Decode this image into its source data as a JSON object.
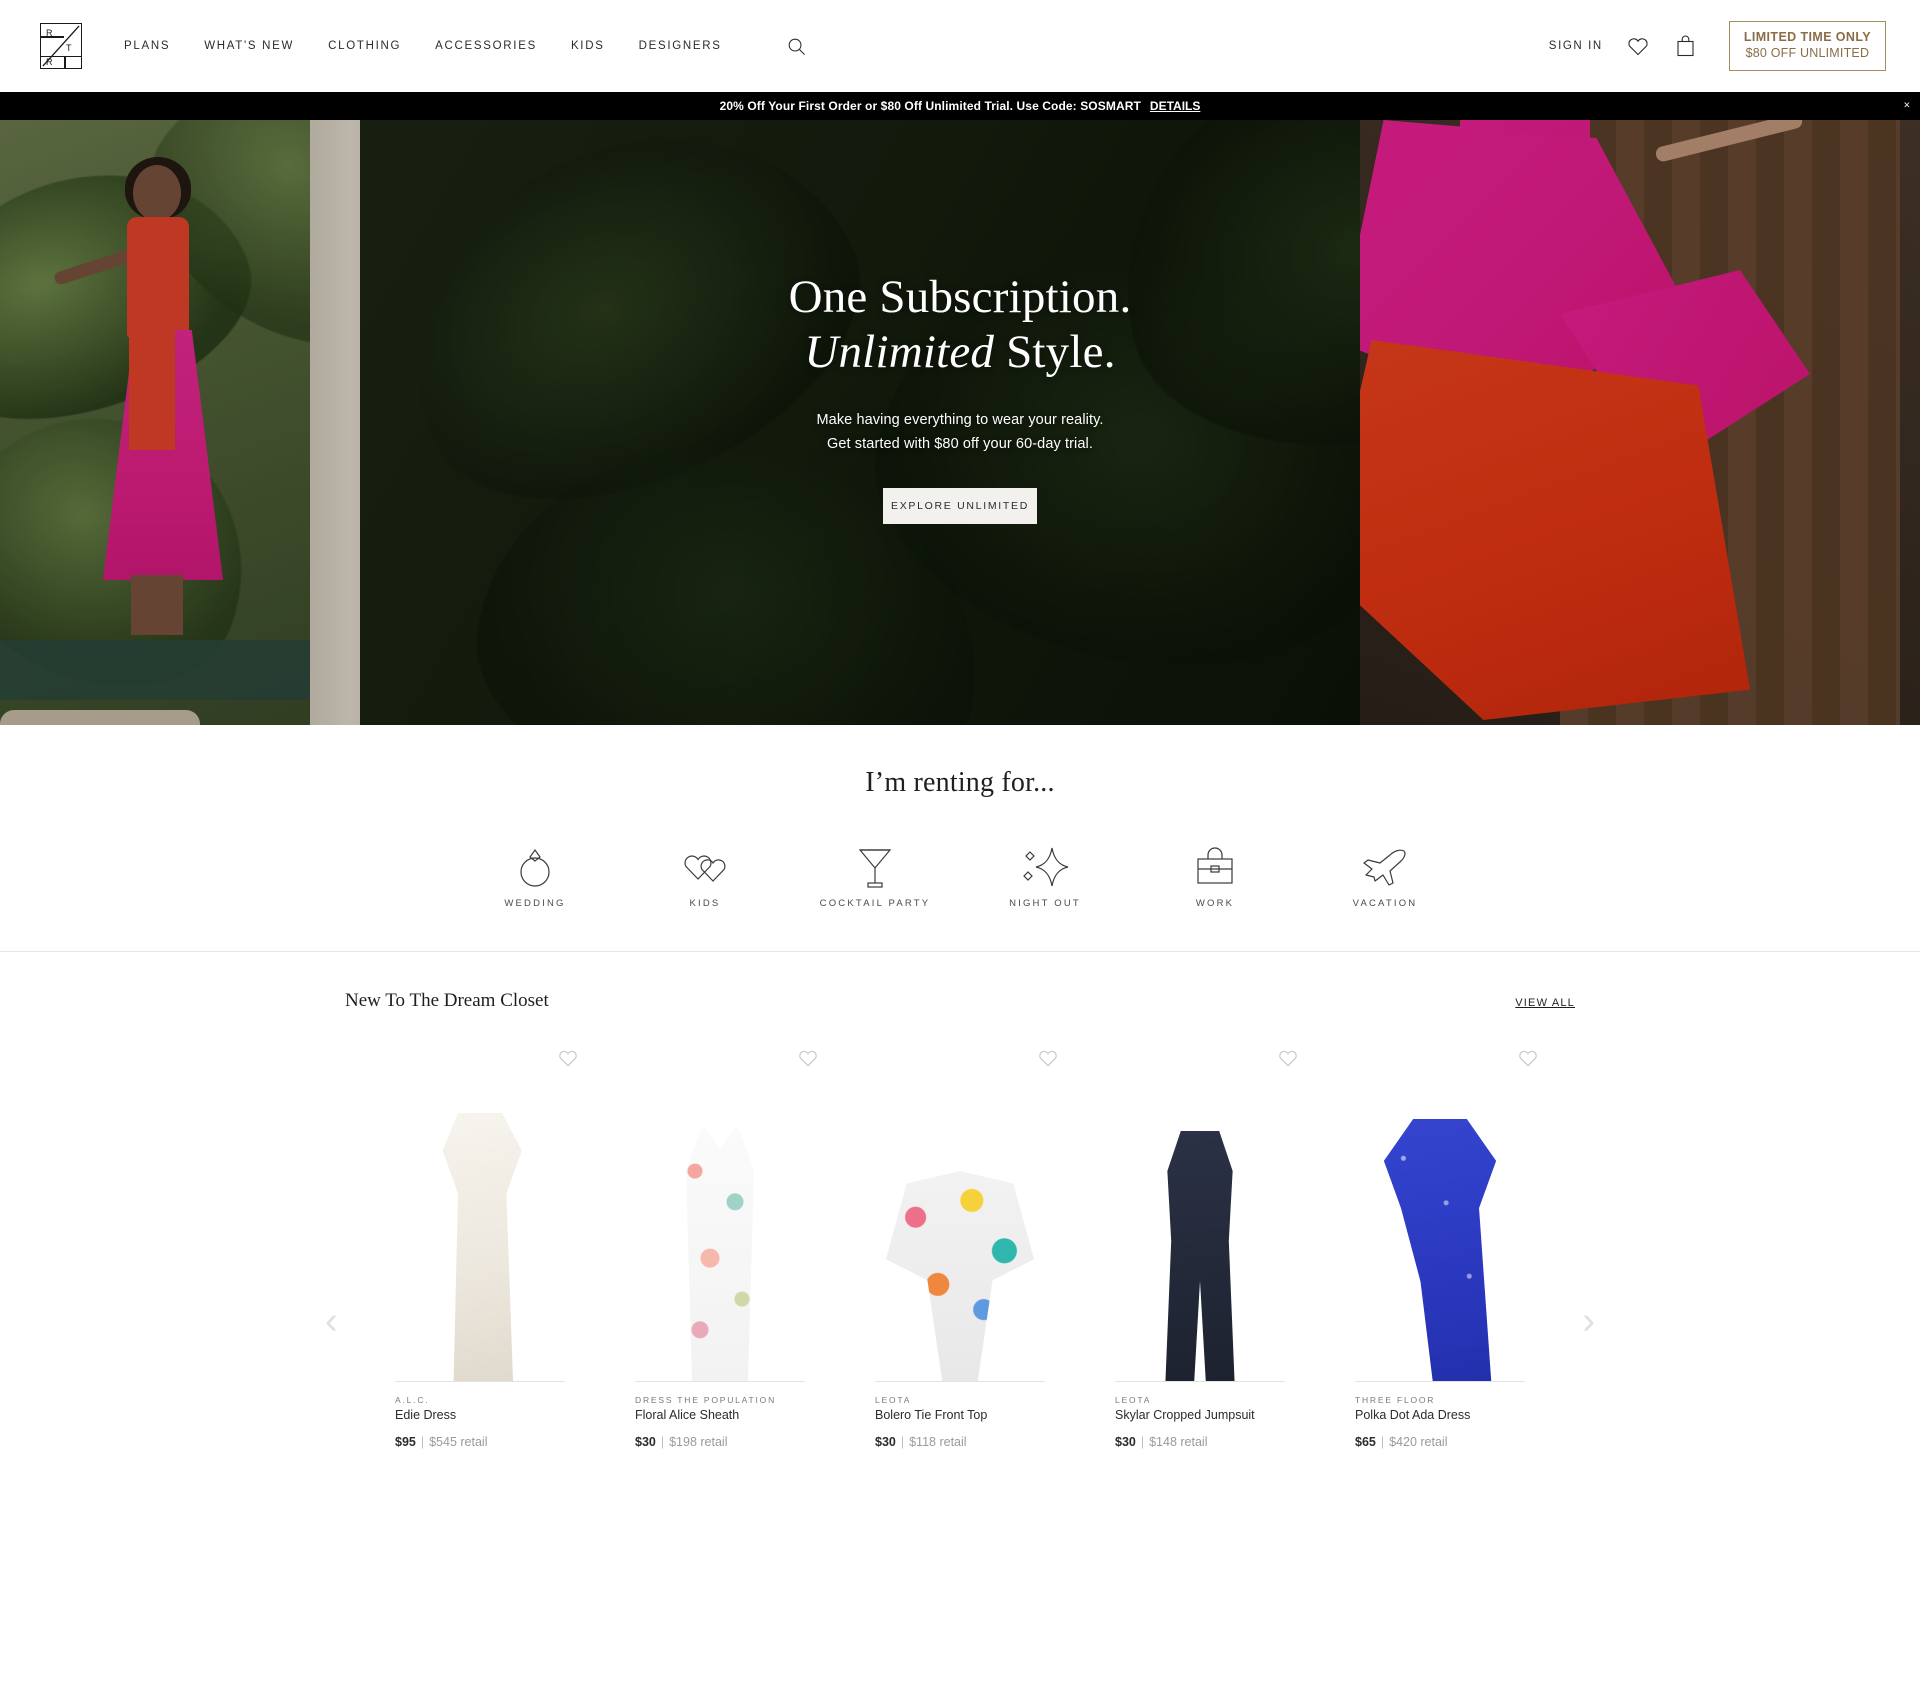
{
  "header": {
    "logo_letters": [
      "R",
      "T",
      "R"
    ],
    "nav": [
      {
        "label": "PLANS"
      },
      {
        "label": "WHAT'S NEW"
      },
      {
        "label": "CLOTHING"
      },
      {
        "label": "ACCESSORIES"
      },
      {
        "label": "KIDS"
      },
      {
        "label": "DESIGNERS"
      }
    ],
    "search_icon": "search-icon",
    "sign_in": "SIGN IN",
    "heart_icon": "heart-icon",
    "bag_icon": "shopping-bag-icon",
    "promo": {
      "line1": "LIMITED TIME ONLY",
      "line2": "$80 OFF UNLIMITED",
      "border_color": "#a98a62",
      "text_color": "#8a6d48"
    }
  },
  "banner": {
    "text": "20% Off Your First Order or $80 Off Unlimited Trial. Use Code: SOSMART",
    "details_label": "DETAILS",
    "close_label": "×",
    "background": "#000000",
    "text_color": "#ffffff"
  },
  "hero": {
    "headline_line1": "One Subscription.",
    "headline_line2_italic": "Unlimited",
    "headline_line2_rest": " Style.",
    "sub_line1": "Make having everything to wear your reality.",
    "sub_line2": "Get started with $80 off your 60-day trial.",
    "cta_label": "EXPLORE UNLIMITED"
  },
  "renting": {
    "title": "I’m renting for...",
    "categories": [
      {
        "label": "WEDDING",
        "icon": "ring-icon"
      },
      {
        "label": "KIDS",
        "icon": "hearts-icon"
      },
      {
        "label": "COCKTAIL PARTY",
        "icon": "martini-glass-icon"
      },
      {
        "label": "NIGHT OUT",
        "icon": "sparkles-icon"
      },
      {
        "label": "WORK",
        "icon": "briefcase-icon"
      },
      {
        "label": "VACATION",
        "icon": "airplane-icon"
      }
    ]
  },
  "products": {
    "section_title": "New To The Dream Closet",
    "view_all_label": "VIEW ALL",
    "prev_arrow": "‹",
    "next_arrow": "›",
    "price_separator": "|",
    "retail_suffix": "retail",
    "items": [
      {
        "brand": "A.L.C.",
        "name": "Edie Dress",
        "price": "$95",
        "retail": "$545 retail",
        "favorite_icon": "heart-icon"
      },
      {
        "brand": "DRESS THE POPULATION",
        "name": "Floral Alice Sheath",
        "price": "$30",
        "retail": "$198 retail",
        "favorite_icon": "heart-icon"
      },
      {
        "brand": "LEOTA",
        "name": "Bolero Tie Front Top",
        "price": "$30",
        "retail": "$118 retail",
        "favorite_icon": "heart-icon"
      },
      {
        "brand": "LEOTA",
        "name": "Skylar Cropped Jumpsuit",
        "price": "$30",
        "retail": "$148 retail",
        "favorite_icon": "heart-icon"
      },
      {
        "brand": "THREE FLOOR",
        "name": "Polka Dot Ada Dress",
        "price": "$65",
        "retail": "$420 retail",
        "favorite_icon": "heart-icon"
      }
    ]
  }
}
